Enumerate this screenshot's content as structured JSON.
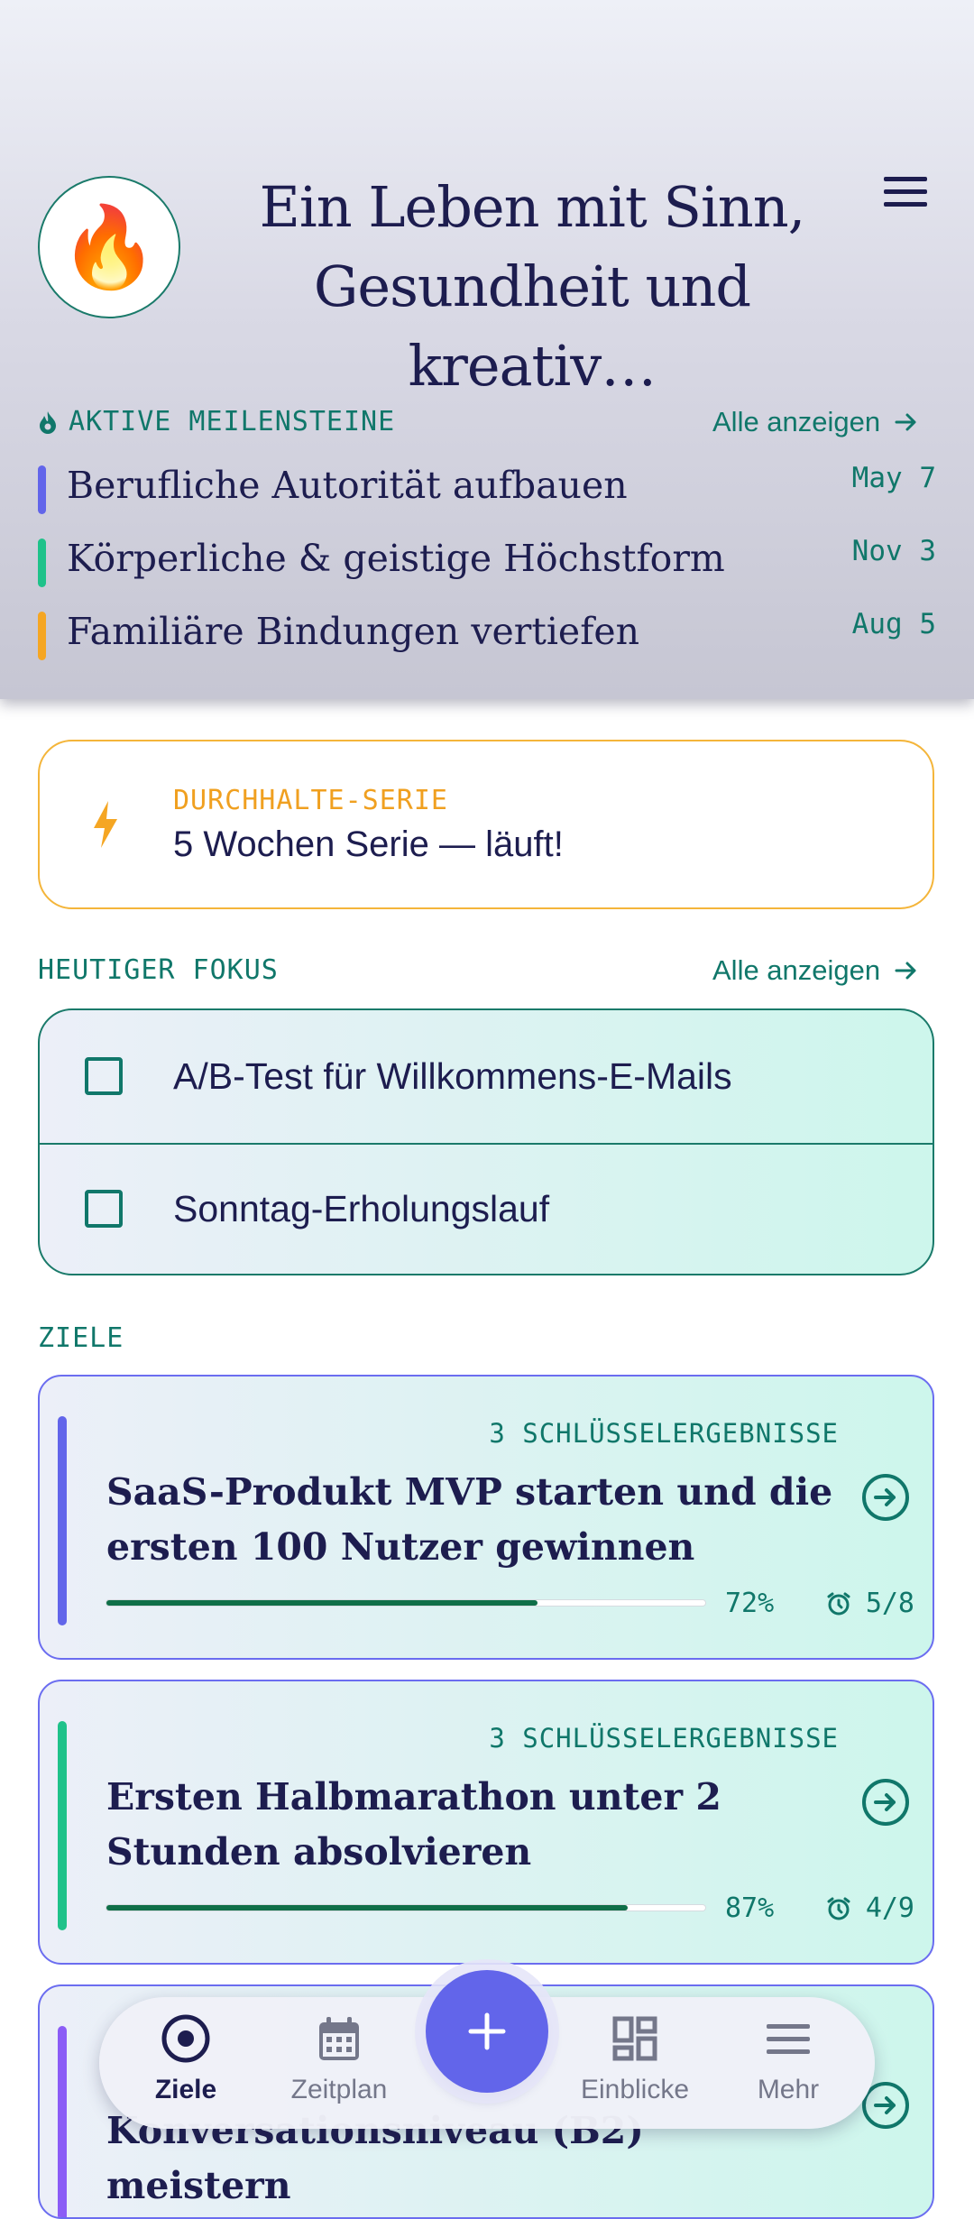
{
  "header": {
    "avatar_emoji": "🔥",
    "title": "Ein Leben mit Sinn, Gesundheit und kreativ…"
  },
  "milestones": {
    "label": "AKTIVE MEILENSTEINE",
    "see_all": "Alle anzeigen",
    "items": [
      {
        "text": "Berufliche Autorität aufbauen",
        "date": "May 7",
        "color": "#6265ea"
      },
      {
        "text": "Körperliche & geistige Höchstform",
        "date": "Nov 3",
        "color": "#1fc28a"
      },
      {
        "text": "Familiäre Bindungen vertiefen",
        "date": "Aug 5",
        "color": "#f5a623"
      }
    ]
  },
  "streak": {
    "label": "DURCHHALTE-SERIE",
    "text": "5 Wochen Serie — läuft!"
  },
  "focus": {
    "label": "HEUTIGER FOKUS",
    "see_all": "Alle anzeigen",
    "items": [
      {
        "text": "A/B-Test für Willkommens-E-Mails",
        "checked": false
      },
      {
        "text": "Sonntag-Erholungslauf",
        "checked": false
      }
    ]
  },
  "goals": {
    "label": "ZIELE",
    "items": [
      {
        "kr": "3 SCHLÜSSELERGEBNISSE",
        "title": "SaaS-Produkt MVP starten und die ersten 100 Nutzer gewinnen",
        "progress": 72,
        "progress_label": "72%",
        "count": "5/8",
        "color": "#6265ea"
      },
      {
        "kr": "3 SCHLÜSSELERGEBNISSE",
        "title": "Ersten Halbmarathon unter 2 Stunden absolvieren",
        "progress": 87,
        "progress_label": "87%",
        "count": "4/9",
        "color": "#1fc28a"
      },
      {
        "kr": "",
        "title": "Konversationsniveau (B2) meistern",
        "progress": 0,
        "progress_label": "",
        "count": "",
        "color": "#8b5cf6"
      }
    ]
  },
  "nav": {
    "items": [
      {
        "label": "Ziele",
        "icon": "target-icon",
        "active": true
      },
      {
        "label": "Zeitplan",
        "icon": "calendar-icon",
        "active": false
      },
      {
        "label": "Einblicke",
        "icon": "dashboard-icon",
        "active": false
      },
      {
        "label": "Mehr",
        "icon": "menu-icon",
        "active": false
      }
    ],
    "fab_icon": "plus-icon"
  }
}
